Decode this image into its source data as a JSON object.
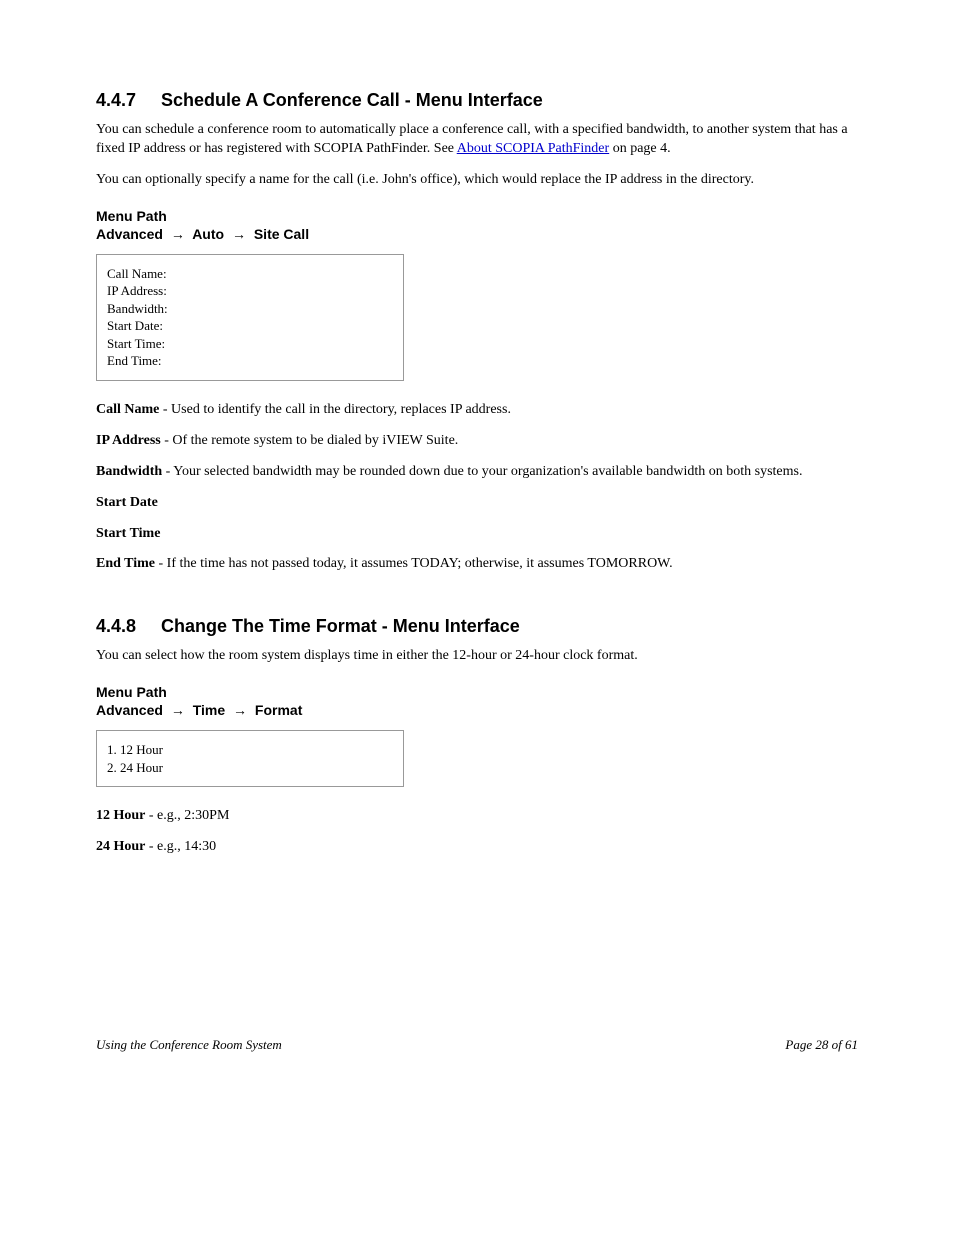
{
  "section1": {
    "number": "4.4.7",
    "title": "Schedule A Conference Call - Menu Interface",
    "p1_a": "You can schedule a conference room to automatically place a conference call, with a specified bandwidth, to another system that has a fixed IP address or has registered with SCOPIA PathFinder. See ",
    "p1_link": "About SCOPIA PathFinder",
    "p1_b": " on page 4. ",
    "p2": "You can optionally specify a name for the call (i.e. John's office), which would replace the IP address in the directory. ",
    "sub_label": "Menu Path",
    "menu": [
      "Advanced ",
      "Auto ",
      "Site Call"
    ],
    "codebox": "Call Name:\nIP Address:\nBandwidth:\nStart Date:\nStart Time:\nEnd Time:",
    "bullets": [
      {
        "label": "Call Name",
        "text": " - Used to identify the call in the directory, replaces IP address."
      },
      {
        "label": "IP Address",
        "text": " - Of the remote system to be dialed by iVIEW Suite."
      },
      {
        "label": "Bandwidth",
        "text": " - Your selected bandwidth may be rounded down due to your organization's available bandwidth on both systems."
      },
      {
        "label": "Start Date",
        "text": ""
      },
      {
        "label": "Start Time",
        "text": ""
      },
      {
        "label": "End Time",
        "text": " - If the time has not passed today, it assumes TODAY; otherwise, it assumes TOMORROW. "
      }
    ]
  },
  "section2": {
    "number": "4.4.8",
    "title": "Change The Time Format - Menu Interface",
    "p1": "You can select how the room system displays time in either the 12-hour or 24-hour clock format. ",
    "sub_label": "Menu Path",
    "menu": [
      "Advanced ",
      "Time ",
      "Format"
    ],
    "codebox": "1. 12 Hour\n2. 24 Hour",
    "bullets": [
      {
        "label": "12 Hour",
        "text": " - e.g., 2:30PM"
      },
      {
        "label": "24 Hour",
        "text": " - e.g., 14:30"
      }
    ]
  },
  "footer": {
    "left": "Using the Conference Room System",
    "right": "Page 28 of 61"
  }
}
